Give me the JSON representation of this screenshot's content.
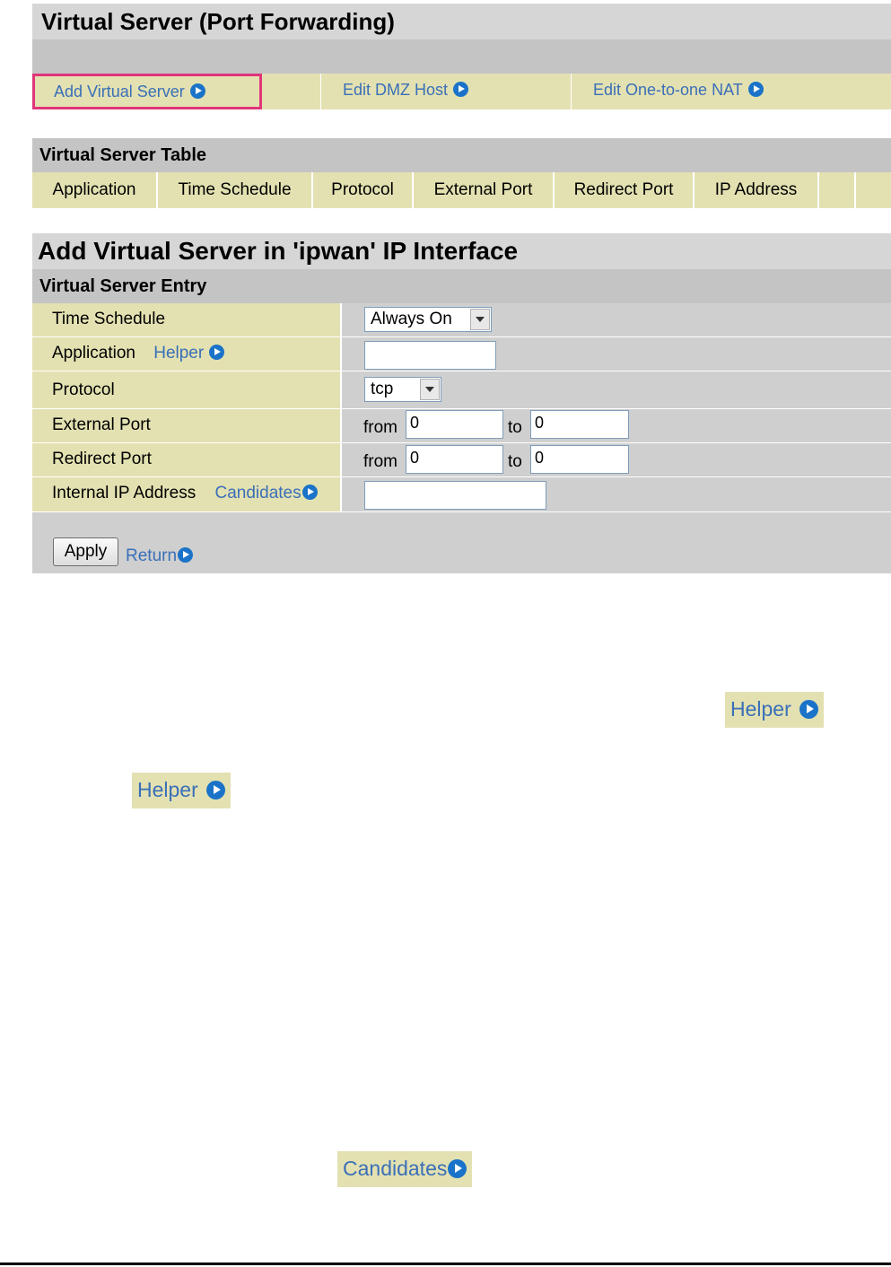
{
  "page": {
    "title": "Virtual Server (Port Forwarding)"
  },
  "nav": [
    {
      "label": "Add Virtual Server"
    },
    {
      "label": "Edit DMZ Host"
    },
    {
      "label": "Edit One-to-one NAT"
    }
  ],
  "table": {
    "title": "Virtual Server Table",
    "columns": [
      "Application",
      "Time Schedule",
      "Protocol",
      "External Port",
      "Redirect Port",
      "IP Address",
      ""
    ]
  },
  "section": {
    "title": "Add Virtual Server in 'ipwan' IP Interface",
    "subtitle": "Virtual Server Entry"
  },
  "form": {
    "time_schedule": {
      "label": "Time Schedule",
      "value": "Always On"
    },
    "application": {
      "label": "Application",
      "helper": "Helper",
      "value": ""
    },
    "protocol": {
      "label": "Protocol",
      "value": "tcp"
    },
    "external_port": {
      "label": "External Port",
      "from_label": "from",
      "from": "0",
      "to_label": "to",
      "to": "0"
    },
    "redirect_port": {
      "label": "Redirect Port",
      "from_label": "from",
      "from": "0",
      "to_label": "to",
      "to": "0"
    },
    "internal_ip": {
      "label": "Internal IP Address",
      "candidates": "Candidates",
      "value": ""
    },
    "apply": "Apply",
    "return": "Return"
  },
  "callouts": {
    "helper_1": "Helper",
    "helper_2": "Helper",
    "candidates": "Candidates"
  },
  "colors": {
    "header_gray": "#d6d6d6",
    "strip_gray": "#c4c4c4",
    "khaki": "#e3e1b1",
    "link_blue": "#3a6fb8",
    "active_border": "#e0357a"
  }
}
